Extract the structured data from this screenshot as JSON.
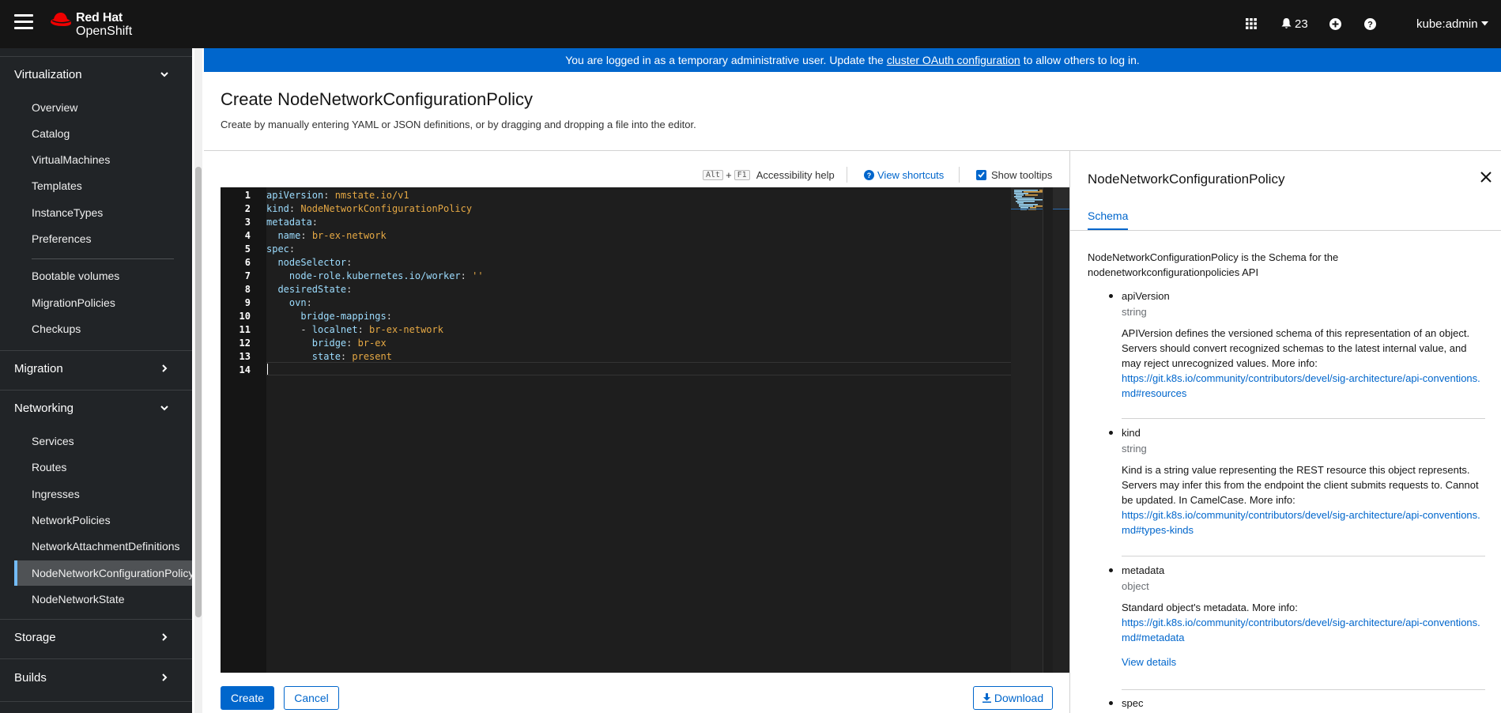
{
  "masthead": {
    "brand_line1": "Red Hat",
    "brand_line2": "OpenShift",
    "notifications_count": "23",
    "user": "kube:admin"
  },
  "sidebar": {
    "sections": [
      {
        "label": "Virtualization",
        "expanded": true
      },
      {
        "label": "Migration",
        "expanded": false
      },
      {
        "label": "Networking",
        "expanded": true
      },
      {
        "label": "Storage",
        "expanded": false
      },
      {
        "label": "Builds",
        "expanded": false
      }
    ],
    "virtualization_items": [
      "Overview",
      "Catalog",
      "VirtualMachines",
      "Templates",
      "InstanceTypes",
      "Preferences"
    ],
    "virtualization_items2": [
      "Bootable volumes",
      "MigrationPolicies",
      "Checkups"
    ],
    "networking_items": [
      "Services",
      "Routes",
      "Ingresses",
      "NetworkPolicies",
      "NetworkAttachmentDefinitions",
      "NodeNetworkConfigurationPolicy",
      "NodeNetworkState"
    ],
    "active_item": "NodeNetworkConfigurationPolicy"
  },
  "banner": {
    "text_before": "You are logged in as a temporary administrative user. Update the",
    "link": "cluster OAuth configuration",
    "text_after": "to allow others to log in."
  },
  "page": {
    "title": "Create NodeNetworkConfigurationPolicy",
    "description": "Create by manually entering YAML or JSON definitions, or by dragging and dropping a file into the editor."
  },
  "toolbar": {
    "key1": "Alt",
    "plus": "+",
    "key2": "F1",
    "accessibility_help": "Accessibility help",
    "view_shortcuts": "View shortcuts",
    "show_tooltips": "Show tooltips"
  },
  "editor": {
    "line_numbers": [
      "1",
      "2",
      "3",
      "4",
      "5",
      "6",
      "7",
      "8",
      "9",
      "10",
      "11",
      "12",
      "13",
      "14"
    ],
    "lines": [
      {
        "indent": "",
        "key": "apiVersion",
        "sep": ": ",
        "value": "nmstate.io/v1"
      },
      {
        "indent": "",
        "key": "kind",
        "sep": ": ",
        "value": "NodeNetworkConfigurationPolicy"
      },
      {
        "indent": "",
        "key": "metadata",
        "sep": ":",
        "value": ""
      },
      {
        "indent": "  ",
        "key": "name",
        "sep": ": ",
        "value": "br-ex-network"
      },
      {
        "indent": "",
        "key": "spec",
        "sep": ":",
        "value": ""
      },
      {
        "indent": "  ",
        "key": "nodeSelector",
        "sep": ":",
        "value": ""
      },
      {
        "indent": "    ",
        "key": "node-role.kubernetes.io/worker",
        "sep": ": ",
        "value": "''"
      },
      {
        "indent": "  ",
        "key": "desiredState",
        "sep": ":",
        "value": ""
      },
      {
        "indent": "    ",
        "key": "ovn",
        "sep": ":",
        "value": ""
      },
      {
        "indent": "      ",
        "key": "bridge-mappings",
        "sep": ":",
        "value": ""
      },
      {
        "indent": "      - ",
        "key": "localnet",
        "sep": ": ",
        "value": "br-ex-network"
      },
      {
        "indent": "        ",
        "key": "bridge",
        "sep": ": ",
        "value": "br-ex"
      },
      {
        "indent": "        ",
        "key": "state",
        "sep": ": ",
        "value": "present"
      },
      {
        "indent": "",
        "key": "",
        "sep": "",
        "value": ""
      }
    ]
  },
  "actions": {
    "create": "Create",
    "cancel": "Cancel",
    "download": "Download"
  },
  "schema_panel": {
    "title": "NodeNetworkConfigurationPolicy",
    "tab": "Schema",
    "description": "NodeNetworkConfigurationPolicy is the Schema for the nodenetworkconfigurationpolicies API",
    "fields": [
      {
        "name": "apiVersion",
        "type": "string",
        "description": "APIVersion defines the versioned schema of this representation of an object. Servers should convert recognized schemas to the latest internal value, and may reject unrecognized values. More info:",
        "link": "https://git.k8s.io/community/contributors/devel/sig-architecture/api-conventions.md#resources"
      },
      {
        "name": "kind",
        "type": "string",
        "description": "Kind is a string value representing the REST resource this object represents. Servers may infer this from the endpoint the client submits requests to. Cannot be updated. In CamelCase. More info:",
        "link": "https://git.k8s.io/community/contributors/devel/sig-architecture/api-conventions.md#types-kinds"
      },
      {
        "name": "metadata",
        "type": "object",
        "description": "Standard object's metadata. More info:",
        "link": "https://git.k8s.io/community/contributors/devel/sig-architecture/api-conventions.md#metadata",
        "more": "View details"
      },
      {
        "name": "spec",
        "type": "",
        "description": "",
        "link": ""
      }
    ]
  }
}
